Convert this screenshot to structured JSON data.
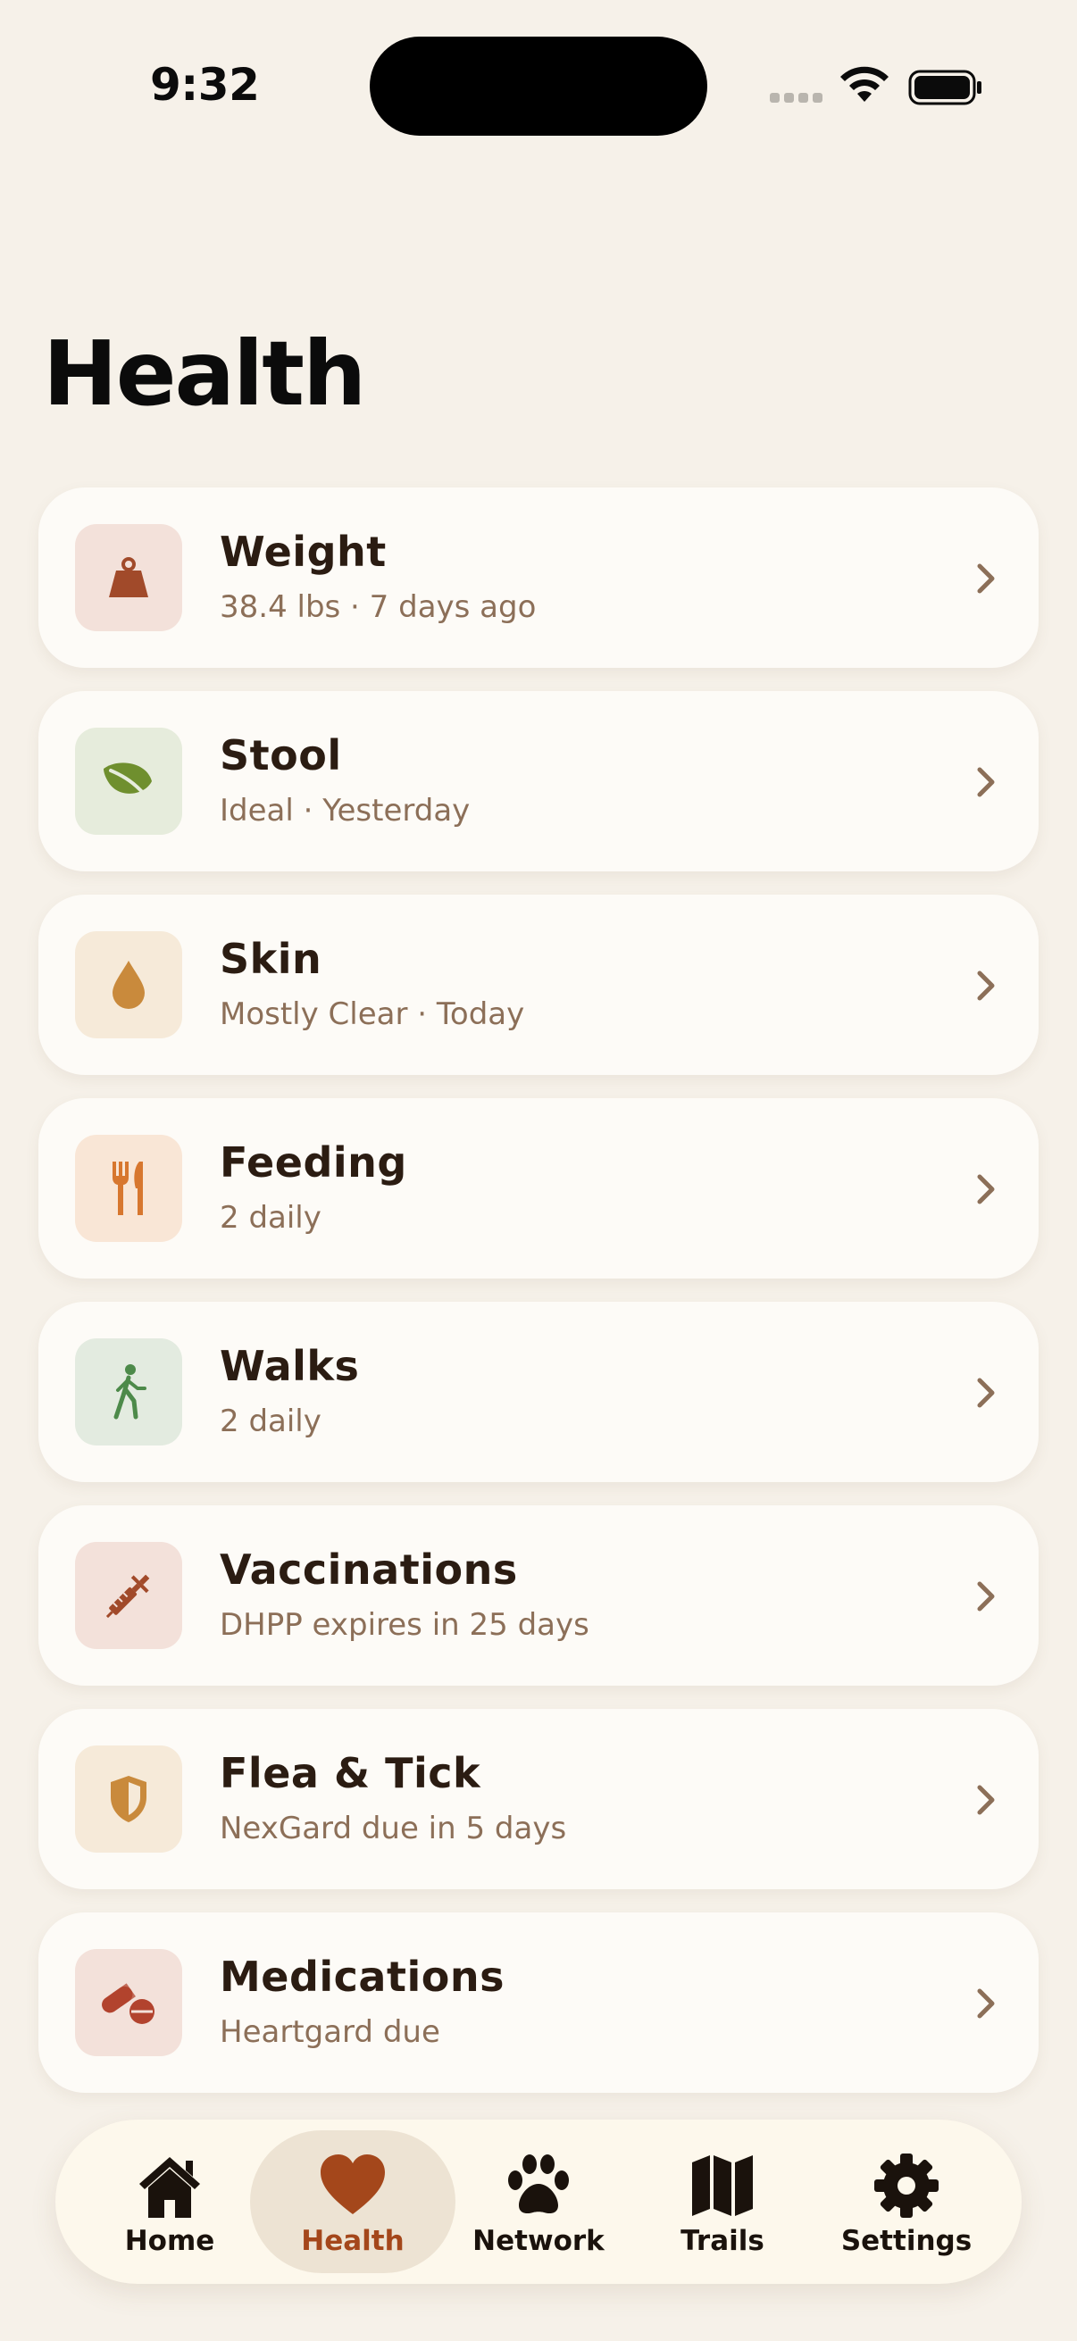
{
  "status": {
    "time": "9:32"
  },
  "page": {
    "title": "Health"
  },
  "items": [
    {
      "title": "Weight",
      "subtitle": "38.4 lbs · 7 days ago",
      "icon": "weight-icon",
      "icon_bg": "#f3e1da",
      "icon_color": "#a14a2a"
    },
    {
      "title": "Stool",
      "subtitle": "Ideal · Yesterday",
      "icon": "leaf-icon",
      "icon_bg": "#e6ecdc",
      "icon_color": "#6f8f2e"
    },
    {
      "title": "Skin",
      "subtitle": "Mostly Clear · Today",
      "icon": "drop-icon",
      "icon_bg": "#f6ead9",
      "icon_color": "#c98a3c"
    },
    {
      "title": "Feeding",
      "subtitle": "2 daily",
      "icon": "fork-knife-icon",
      "icon_bg": "#f9e6d6",
      "icon_color": "#d7772f"
    },
    {
      "title": "Walks",
      "subtitle": "2 daily",
      "icon": "walking-person-icon",
      "icon_bg": "#e3ebe0",
      "icon_color": "#4d8a4a"
    },
    {
      "title": "Vaccinations",
      "subtitle": "DHPP expires in 25 days",
      "icon": "syringe-icon",
      "icon_bg": "#f3e1da",
      "icon_color": "#a14a2a"
    },
    {
      "title": "Flea & Tick",
      "subtitle": "NexGard due in 5 days",
      "icon": "shield-icon",
      "icon_bg": "#f6ead9",
      "icon_color": "#c98a3c"
    },
    {
      "title": "Medications",
      "subtitle": "Heartgard due",
      "icon": "pills-icon",
      "icon_bg": "#f3e1da",
      "icon_color": "#b2432e"
    }
  ],
  "tabs": [
    {
      "label": "Home",
      "icon": "house-icon",
      "active": false
    },
    {
      "label": "Health",
      "icon": "heart-icon",
      "active": true
    },
    {
      "label": "Network",
      "icon": "paw-icon",
      "active": false
    },
    {
      "label": "Trails",
      "icon": "map-icon",
      "active": false
    },
    {
      "label": "Settings",
      "icon": "gear-icon",
      "active": false
    }
  ],
  "colors": {
    "background": "#f6f1e9",
    "card": "#fdfbf7",
    "title_text": "#2b1c12",
    "subtitle_text": "#8c6f58",
    "accent": "#a4471b",
    "chevron": "#8c6f58"
  }
}
